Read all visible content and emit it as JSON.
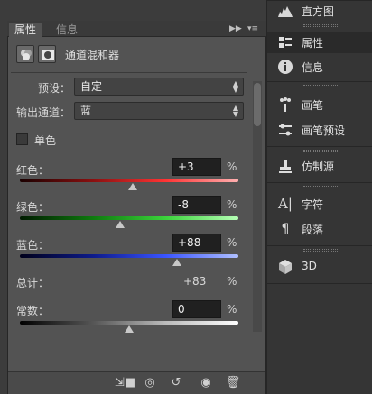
{
  "colors": {
    "panel_bg": "#535353",
    "dock_bg": "#353535",
    "field_bg": "#202020",
    "accent_red": "#d43a3a",
    "accent_green": "#3bbd3b",
    "accent_blue": "#3a4fd4"
  },
  "tabs": {
    "properties": "属性",
    "info": "信息"
  },
  "header": {
    "title": "通道混和器",
    "icons": [
      "channel-mixer-icon",
      "mask-icon"
    ]
  },
  "preset": {
    "label": "预设：",
    "value": "自定"
  },
  "output_channel": {
    "label": "输出通道：",
    "value": "蓝"
  },
  "monochrome": {
    "label": "单色",
    "checked": false
  },
  "sliders": {
    "red": {
      "label": "红色：",
      "value": "+3",
      "unit": "%",
      "level": 0.515
    },
    "green": {
      "label": "绿色：",
      "value": "-8",
      "unit": "%",
      "level": 0.46
    },
    "blue": {
      "label": "蓝色：",
      "value": "+88",
      "unit": "%",
      "level": 0.72
    }
  },
  "total": {
    "label": "总计：",
    "value": "+83",
    "unit": "%"
  },
  "constant": {
    "label": "常数：",
    "value": "0",
    "unit": "%",
    "level": 0.5
  },
  "footer_icons": [
    "clip-to-layer-icon",
    "view-previous-state-icon",
    "reset-icon",
    "visibility-eye-icon",
    "delete-icon"
  ],
  "dock": {
    "items": [
      {
        "label": "直方图",
        "icon": "histogram-icon"
      },
      {
        "label": "属性",
        "icon": "properties-icon"
      },
      {
        "label": "信息",
        "icon": "info-icon"
      },
      {
        "label": "画笔",
        "icon": "brush-icon"
      },
      {
        "label": "画笔预设",
        "icon": "brush-presets-icon"
      },
      {
        "label": "仿制源",
        "icon": "clone-source-icon"
      },
      {
        "label": "字符",
        "icon": "character-icon"
      },
      {
        "label": "段落",
        "icon": "paragraph-icon"
      },
      {
        "label": "3D",
        "icon": "3d-icon"
      }
    ]
  }
}
